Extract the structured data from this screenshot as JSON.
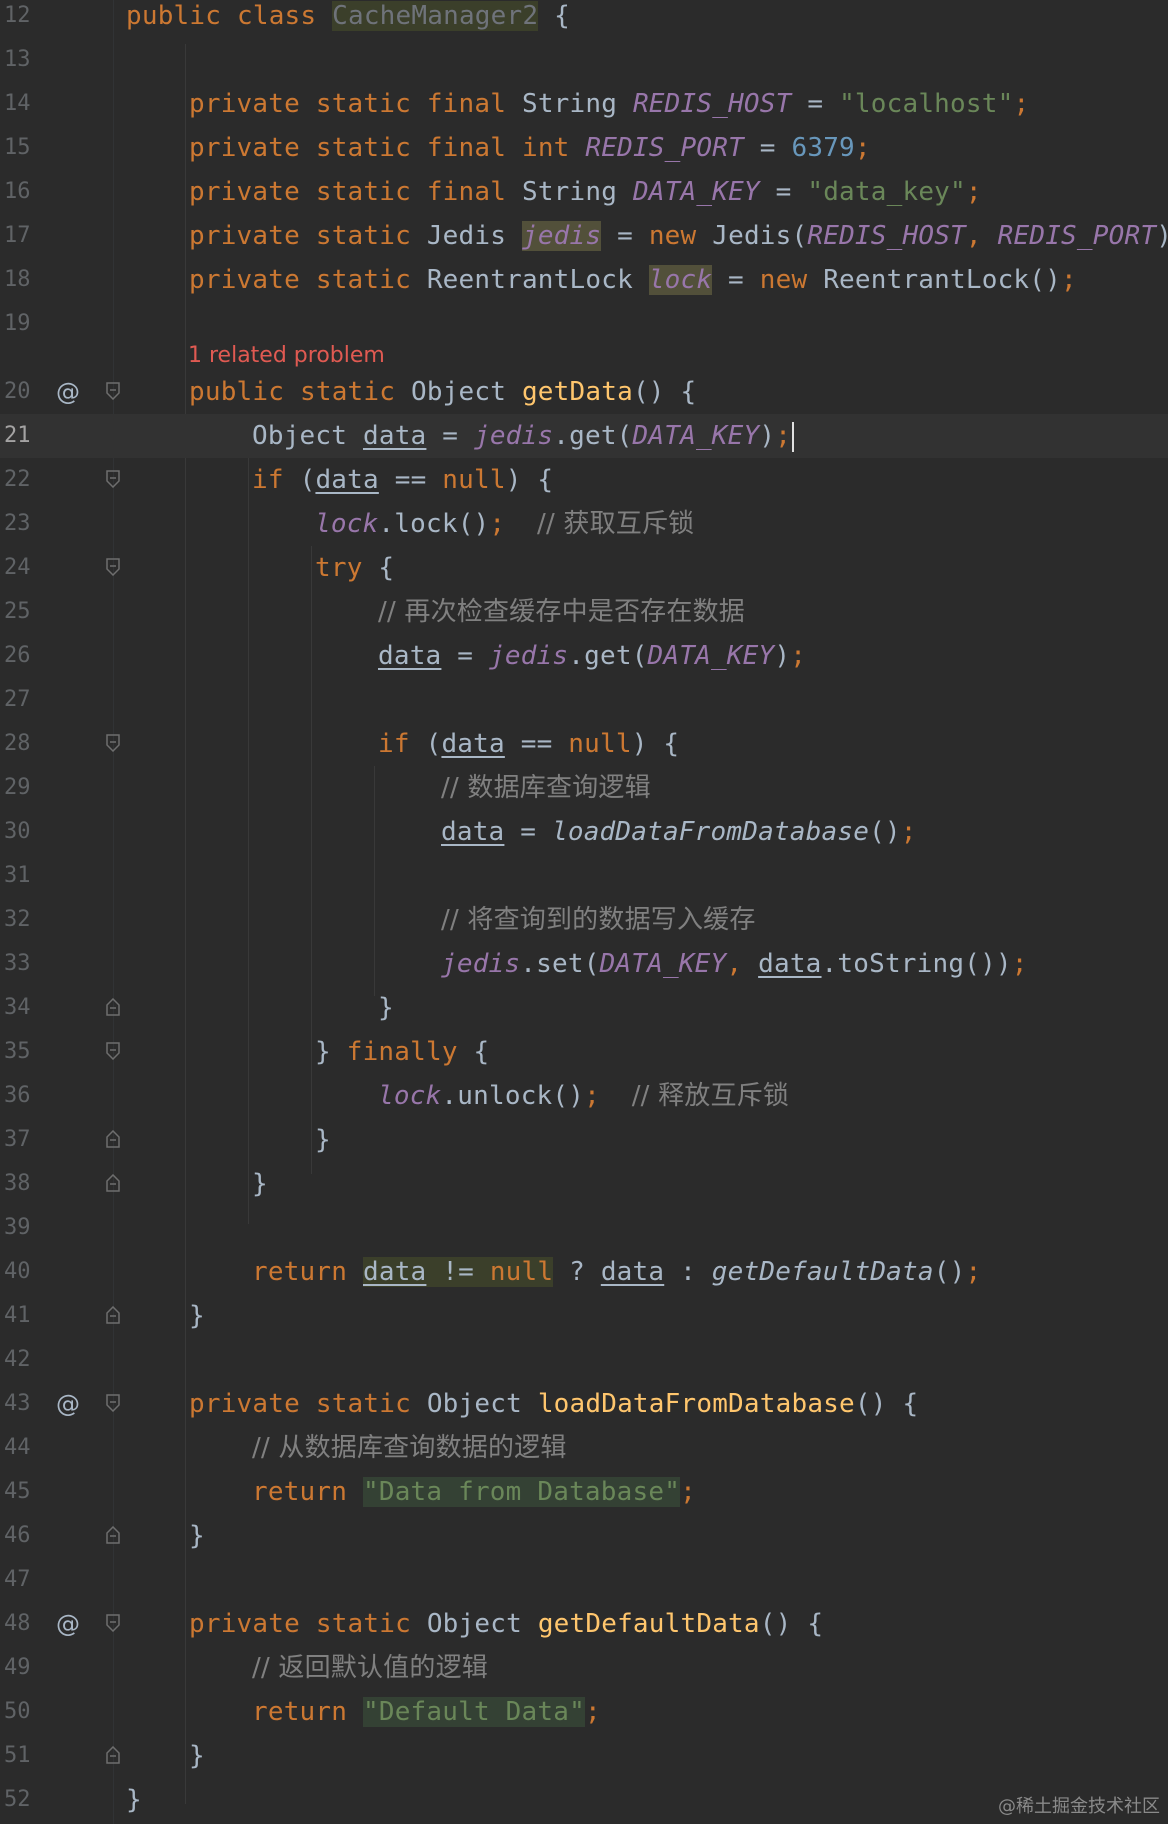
{
  "editor": {
    "class_name": "CacheManager2",
    "hint": "1 related problem",
    "line_numbers": [
      "12",
      "13",
      "14",
      "15",
      "16",
      "17",
      "18",
      "19",
      "20",
      "21",
      "22",
      "23",
      "24",
      "25",
      "26",
      "27",
      "28",
      "29",
      "30",
      "31",
      "32",
      "33",
      "34",
      "35",
      "36",
      "37",
      "38",
      "39",
      "40",
      "41",
      "42",
      "43",
      "44",
      "45",
      "46",
      "47",
      "48",
      "49",
      "50",
      "51",
      "52"
    ],
    "tokens": {
      "public": "public",
      "class": "class",
      "private": "private",
      "static": "static",
      "final": "final",
      "new": "new",
      "if": "if",
      "try": "try",
      "finally": "finally",
      "return": "return",
      "null": "null",
      "int": "int",
      "String": "String",
      "Jedis": "Jedis",
      "ReentrantLock": "ReentrantLock",
      "Object": "Object",
      "REDIS_HOST": "REDIS_HOST",
      "REDIS_PORT": "REDIS_PORT",
      "DATA_KEY": "DATA_KEY",
      "jedis": "jedis",
      "lock": "lock",
      "data": "data",
      "localhost": "\"localhost\"",
      "port": "6379",
      "data_key": "\"data_key\"",
      "getData": "getData",
      "loadDataFromDatabase": "loadDataFromDatabase",
      "getDefaultData": "getDefaultData",
      "get": "get",
      "set": "set",
      "lockm": "lock",
      "unlock": "unlock",
      "toString": "toString",
      "str_db": "\"Data from Database\"",
      "str_default": "\"Default Data\""
    },
    "comments": {
      "acquire_lock": "// 获取互斥锁",
      "recheck": "// 再次检查缓存中是否存在数据",
      "db_query": "// 数据库查询逻辑",
      "write_cache": "// 将查询到的数据写入缓存",
      "release_lock": "// 释放互斥锁",
      "db_logic": "// 从数据库查询数据的逻辑",
      "default_logic": "// 返回默认值的逻辑"
    },
    "implements_marker": "@"
  },
  "watermark": "@稀土掘金技术社区",
  "colors": {
    "background": "#2b2b2b",
    "keyword": "#cc7832",
    "static_field": "#9876aa",
    "string": "#6a8759",
    "number": "#6897bb",
    "method_decl": "#ffc66d",
    "comment": "#808080",
    "error_hint": "#e05a52"
  }
}
